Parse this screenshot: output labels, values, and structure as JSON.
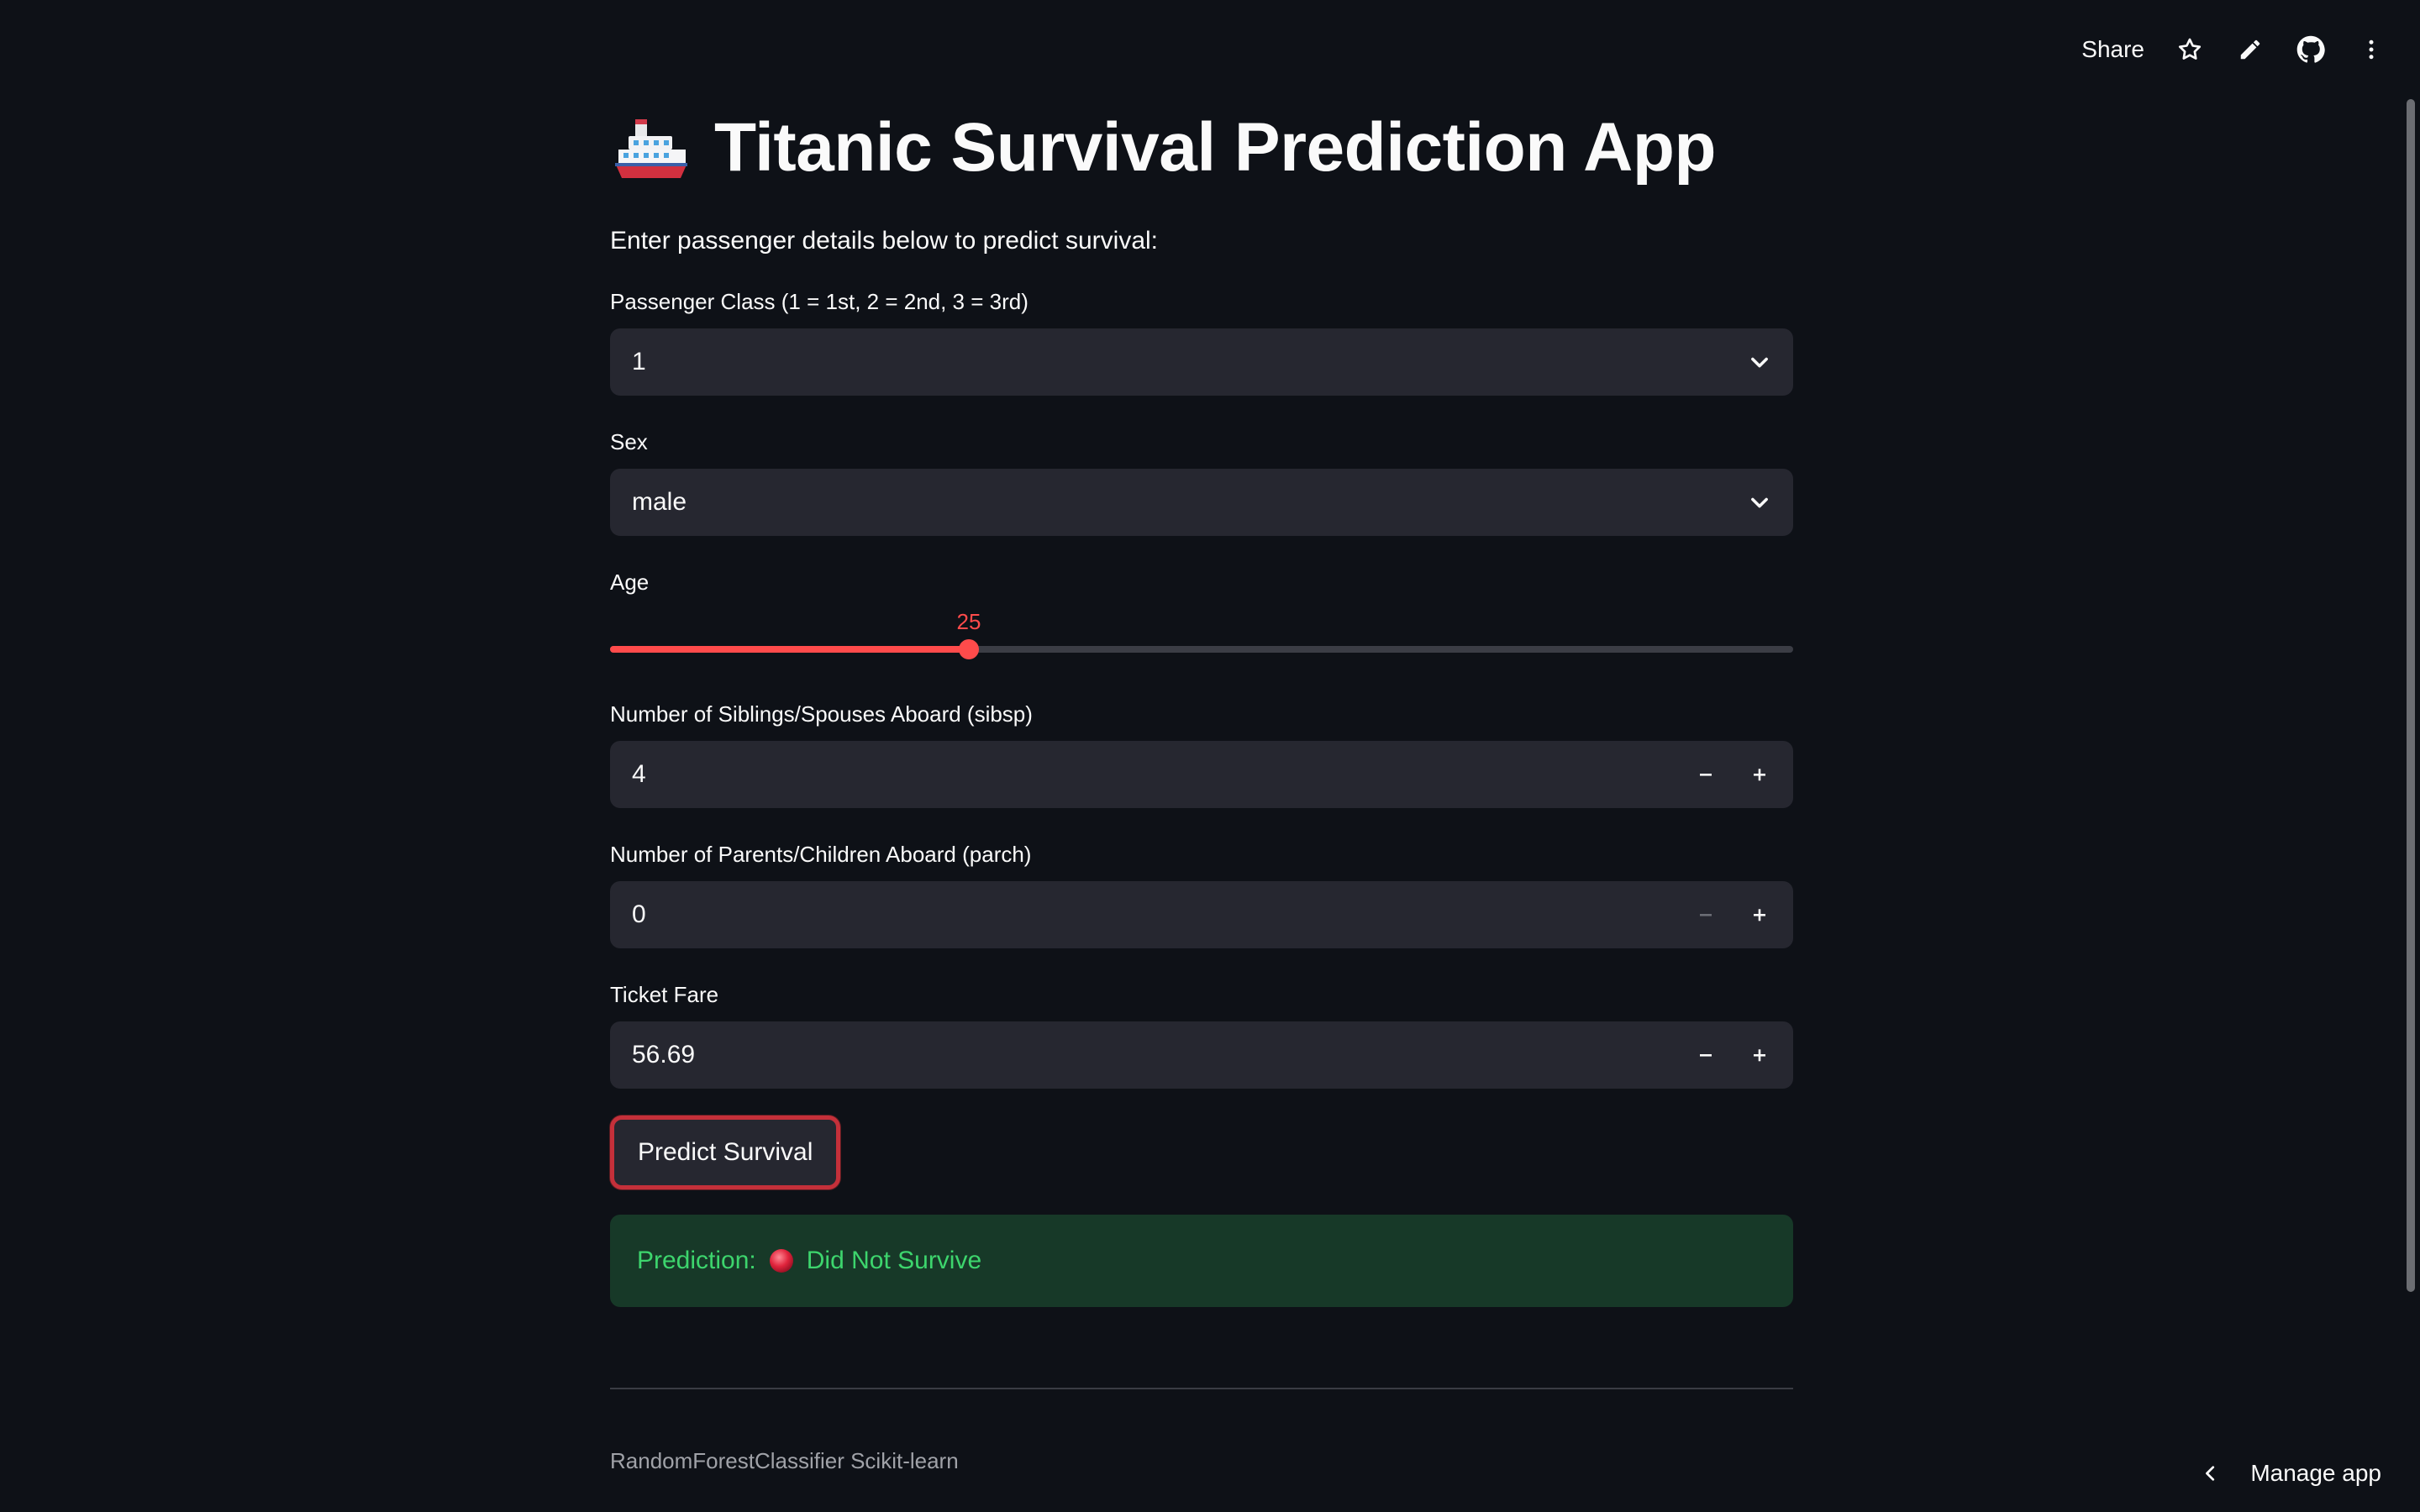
{
  "toolbar": {
    "share_label": "Share",
    "icons": [
      "star-icon",
      "pencil-icon",
      "github-icon",
      "more-vertical-icon"
    ]
  },
  "header": {
    "title": "Titanic Survival Prediction App",
    "title_emoji": "ship-icon",
    "subtitle": "Enter passenger details below to predict survival:"
  },
  "form": {
    "pclass": {
      "label": "Passenger Class (1 = 1st, 2 = 2nd, 3 = 3rd)",
      "value": "1"
    },
    "sex": {
      "label": "Sex",
      "value": "male"
    },
    "age": {
      "label": "Age",
      "value": "25",
      "min": 0,
      "max": 80,
      "fraction": 0.3036
    },
    "sibsp": {
      "label": "Number of Siblings/Spouses Aboard (sibsp)",
      "value": "4"
    },
    "parch": {
      "label": "Number of Parents/Children Aboard (parch)",
      "value": "0"
    },
    "fare": {
      "label": "Ticket Fare",
      "value": "56.69"
    },
    "submit_label": "Predict Survival"
  },
  "result": {
    "prefix": "Prediction:",
    "text": "Did Not Survive",
    "color": "#3dd56d",
    "background": "#173928"
  },
  "footer": {
    "text": "RandomForestClassifier Scikit-learn",
    "manage_label": "Manage app"
  },
  "colors": {
    "background": "#0e1117",
    "accent": "#ff4b4b",
    "input_bg": "#262730"
  }
}
